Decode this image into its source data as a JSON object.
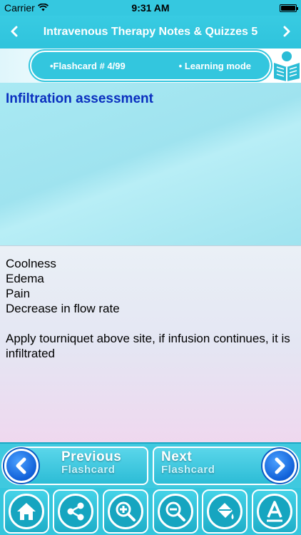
{
  "status_bar": {
    "carrier": "Carrier",
    "time": "9:31 AM",
    "wifi_icon": "wifi-icon",
    "battery_icon": "battery-icon",
    "battery_level": 1.0
  },
  "header": {
    "title": "Intravenous Therapy Notes & Quizzes 5",
    "back_icon": "chevron-left-icon",
    "forward_icon": "chevron-right-icon"
  },
  "info": {
    "flashcard_label": "•Flashcard #  4/99",
    "mode_label": "• Learning mode",
    "mode_icon": "reading-person-icon"
  },
  "question": {
    "title": "Infiltration assessment"
  },
  "answer": {
    "lines": [
      "Coolness",
      "Edema",
      "Pain",
      "Decrease in flow rate"
    ],
    "note": "Apply tourniquet above site, if infusion continues, it is infiltrated"
  },
  "navigation": {
    "previous": {
      "big": "Previous",
      "small": "Flashcard",
      "icon": "arrow-left-icon"
    },
    "next": {
      "big": "Next",
      "small": "Flashcard",
      "icon": "arrow-right-icon"
    }
  },
  "toolbar": {
    "items": [
      {
        "icon": "home-icon"
      },
      {
        "icon": "share-icon"
      },
      {
        "icon": "zoom-in-icon"
      },
      {
        "icon": "zoom-out-icon"
      },
      {
        "icon": "paint-bucket-icon"
      },
      {
        "icon": "font-icon"
      }
    ]
  },
  "colors": {
    "accent": "#35c6dd",
    "title_blue": "#0a2fbf",
    "question_bg": "#a9e9f3",
    "circle_blue": "#1060d8"
  }
}
